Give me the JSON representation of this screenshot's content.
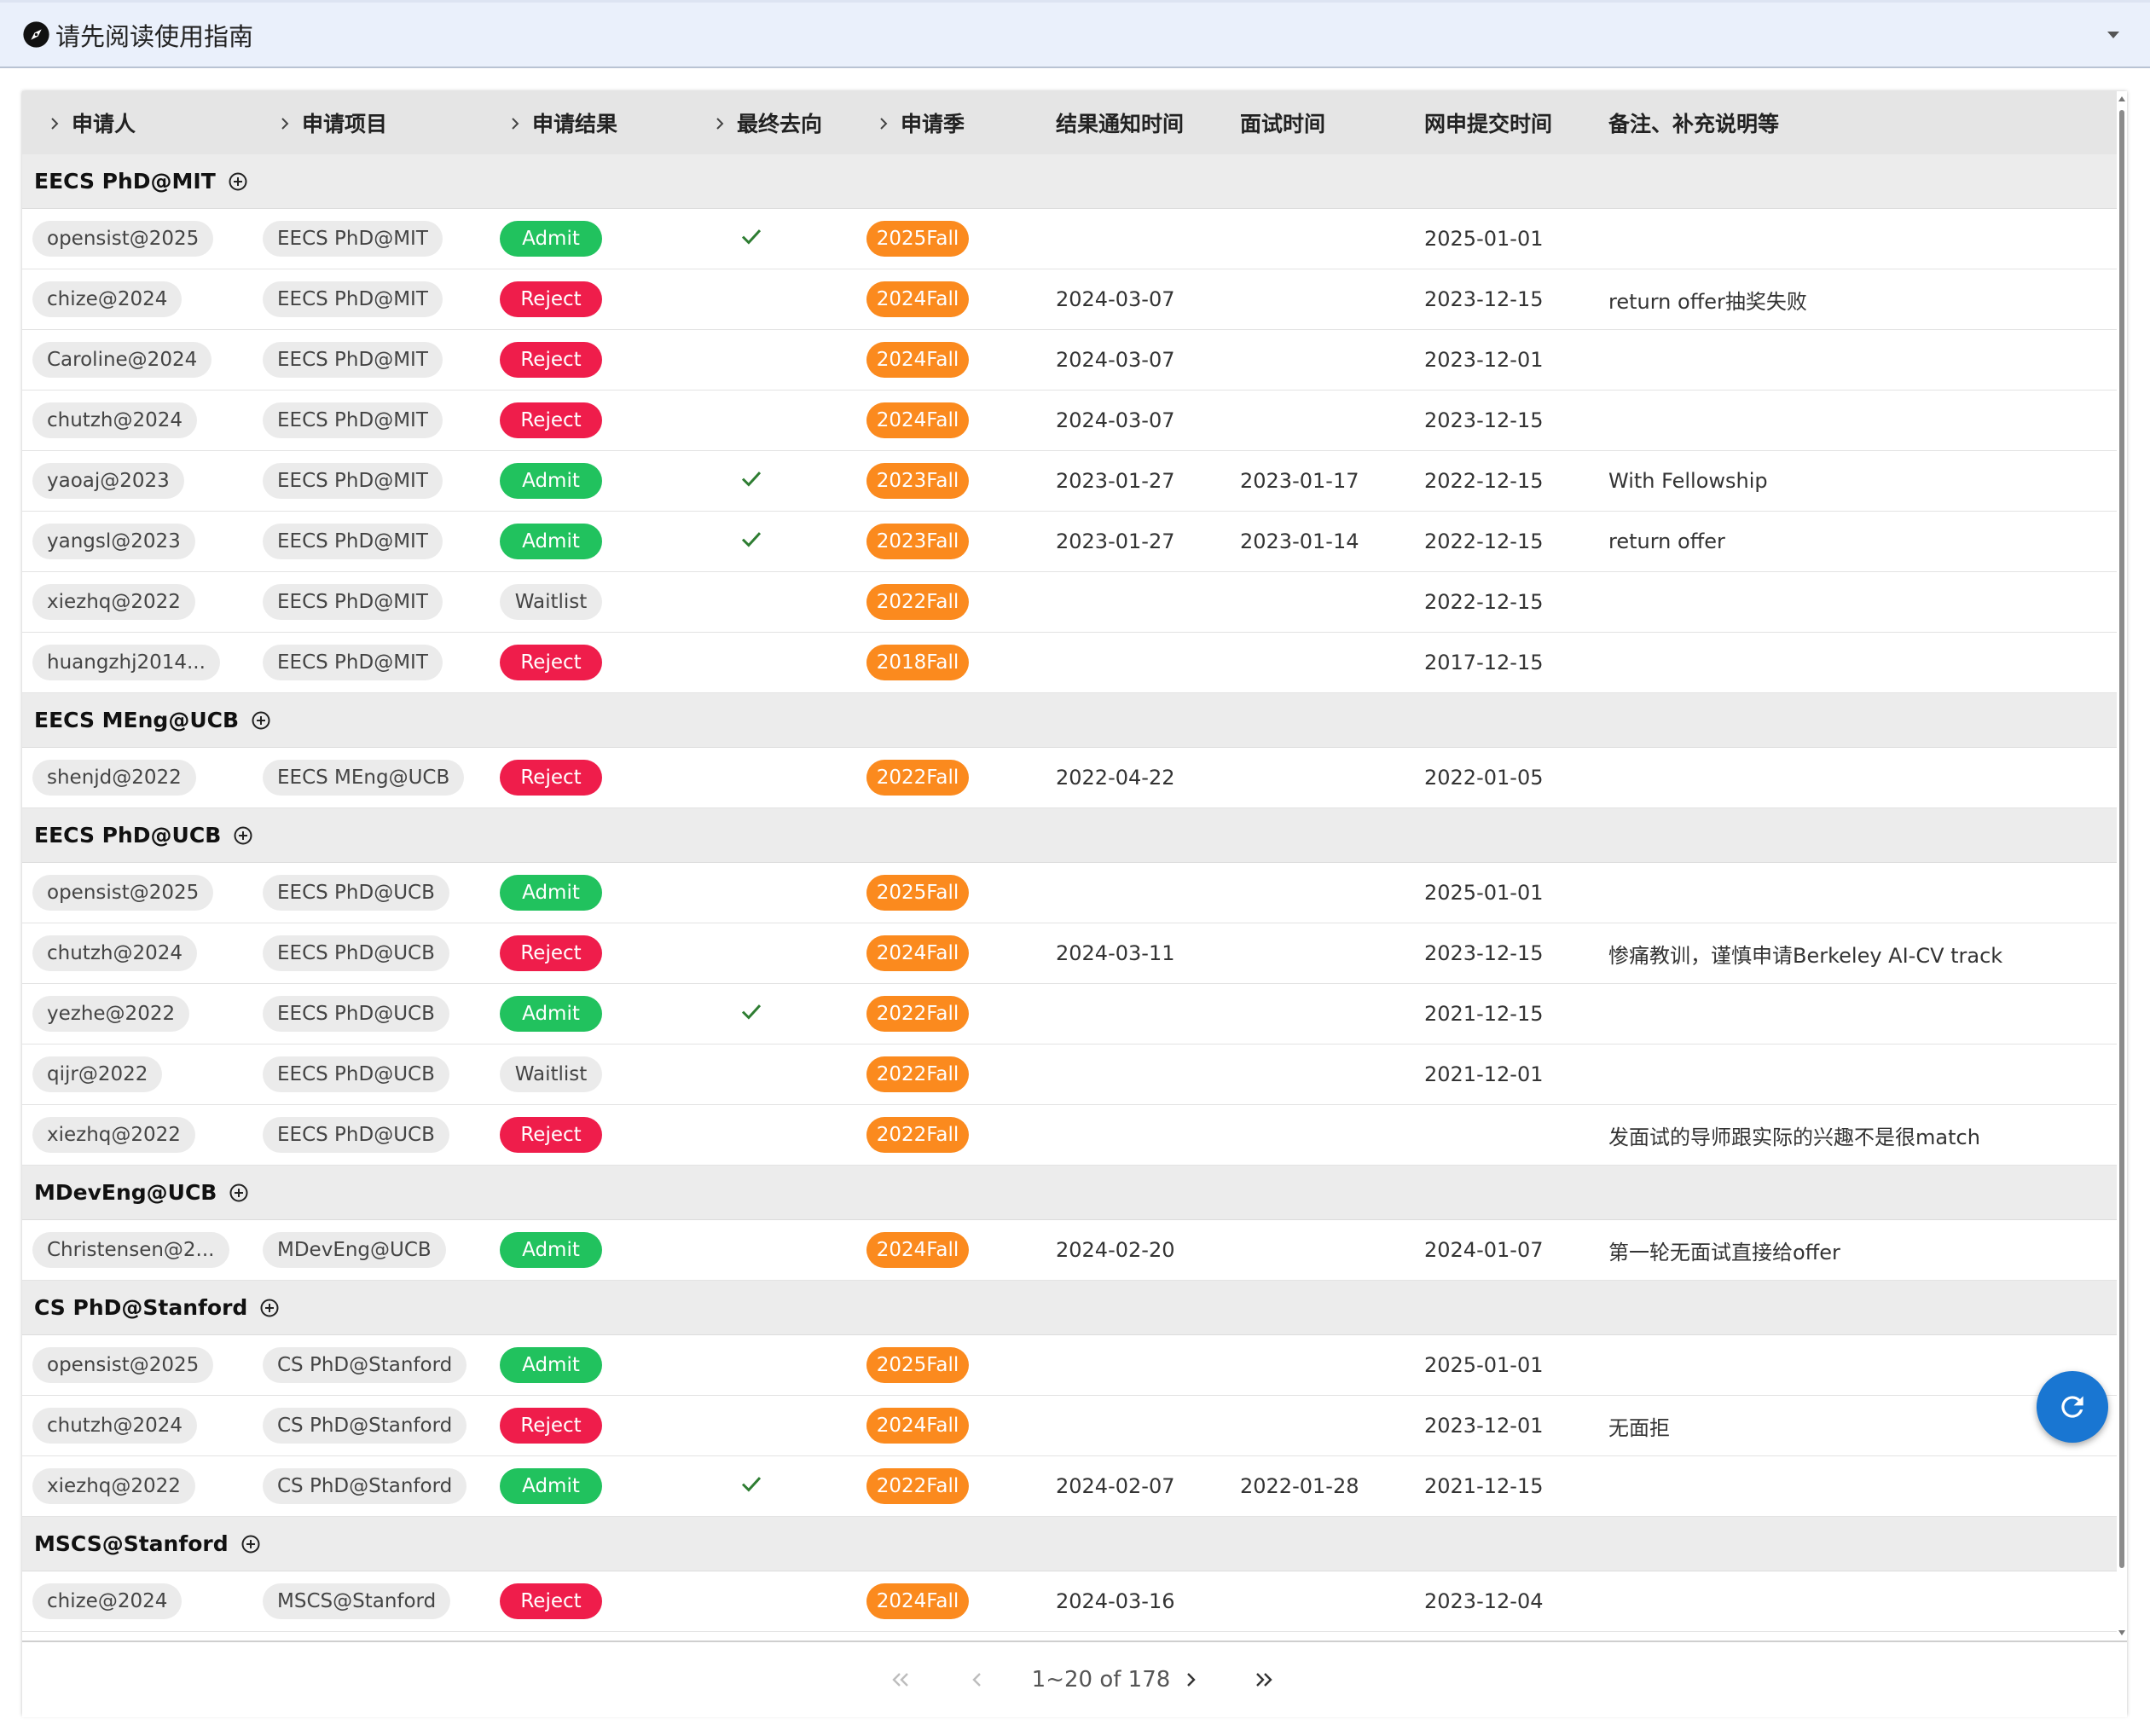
{
  "guide": {
    "title": "请先阅读使用指南"
  },
  "columns": [
    {
      "label": "申请人",
      "sortable": true
    },
    {
      "label": "申请项目",
      "sortable": true
    },
    {
      "label": "申请结果",
      "sortable": true
    },
    {
      "label": "最终去向",
      "sortable": true
    },
    {
      "label": "申请季",
      "sortable": true
    },
    {
      "label": "结果通知时间",
      "sortable": false
    },
    {
      "label": "面试时间",
      "sortable": false
    },
    {
      "label": "网申提交时间",
      "sortable": false
    },
    {
      "label": "备注、补充说明等",
      "sortable": false
    }
  ],
  "groups": [
    {
      "name": "EECS PhD@MIT",
      "rows": [
        {
          "applicant": "opensist@2025",
          "program": "EECS PhD@MIT",
          "result": "Admit",
          "final": true,
          "season": "2025Fall",
          "notify": "",
          "interview": "",
          "submit": "2025-01-01",
          "note": ""
        },
        {
          "applicant": "chize@2024",
          "program": "EECS PhD@MIT",
          "result": "Reject",
          "final": false,
          "season": "2024Fall",
          "notify": "2024-03-07",
          "interview": "",
          "submit": "2023-12-15",
          "note": "return offer抽奖失败"
        },
        {
          "applicant": "Caroline@2024",
          "program": "EECS PhD@MIT",
          "result": "Reject",
          "final": false,
          "season": "2024Fall",
          "notify": "2024-03-07",
          "interview": "",
          "submit": "2023-12-01",
          "note": ""
        },
        {
          "applicant": "chutzh@2024",
          "program": "EECS PhD@MIT",
          "result": "Reject",
          "final": false,
          "season": "2024Fall",
          "notify": "2024-03-07",
          "interview": "",
          "submit": "2023-12-15",
          "note": ""
        },
        {
          "applicant": "yaoaj@2023",
          "program": "EECS PhD@MIT",
          "result": "Admit",
          "final": true,
          "season": "2023Fall",
          "notify": "2023-01-27",
          "interview": "2023-01-17",
          "submit": "2022-12-15",
          "note": "With Fellowship"
        },
        {
          "applicant": "yangsl@2023",
          "program": "EECS PhD@MIT",
          "result": "Admit",
          "final": true,
          "season": "2023Fall",
          "notify": "2023-01-27",
          "interview": "2023-01-14",
          "submit": "2022-12-15",
          "note": "return offer"
        },
        {
          "applicant": "xiezhq@2022",
          "program": "EECS PhD@MIT",
          "result": "Waitlist",
          "final": false,
          "season": "2022Fall",
          "notify": "",
          "interview": "",
          "submit": "2022-12-15",
          "note": ""
        },
        {
          "applicant": "huangzhj2014...",
          "program": "EECS PhD@MIT",
          "result": "Reject",
          "final": false,
          "season": "2018Fall",
          "notify": "",
          "interview": "",
          "submit": "2017-12-15",
          "note": ""
        }
      ]
    },
    {
      "name": "EECS MEng@UCB",
      "rows": [
        {
          "applicant": "shenjd@2022",
          "program": "EECS MEng@UCB",
          "result": "Reject",
          "final": false,
          "season": "2022Fall",
          "notify": "2022-04-22",
          "interview": "",
          "submit": "2022-01-05",
          "note": ""
        }
      ]
    },
    {
      "name": "EECS PhD@UCB",
      "rows": [
        {
          "applicant": "opensist@2025",
          "program": "EECS PhD@UCB",
          "result": "Admit",
          "final": false,
          "season": "2025Fall",
          "notify": "",
          "interview": "",
          "submit": "2025-01-01",
          "note": ""
        },
        {
          "applicant": "chutzh@2024",
          "program": "EECS PhD@UCB",
          "result": "Reject",
          "final": false,
          "season": "2024Fall",
          "notify": "2024-03-11",
          "interview": "",
          "submit": "2023-12-15",
          "note": "惨痛教训，谨慎申请Berkeley AI-CV track"
        },
        {
          "applicant": "yezhe@2022",
          "program": "EECS PhD@UCB",
          "result": "Admit",
          "final": true,
          "season": "2022Fall",
          "notify": "",
          "interview": "",
          "submit": "2021-12-15",
          "note": ""
        },
        {
          "applicant": "qijr@2022",
          "program": "EECS PhD@UCB",
          "result": "Waitlist",
          "final": false,
          "season": "2022Fall",
          "notify": "",
          "interview": "",
          "submit": "2021-12-01",
          "note": ""
        },
        {
          "applicant": "xiezhq@2022",
          "program": "EECS PhD@UCB",
          "result": "Reject",
          "final": false,
          "season": "2022Fall",
          "notify": "",
          "interview": "",
          "submit": "",
          "note": "发面试的导师跟实际的兴趣不是很match"
        }
      ]
    },
    {
      "name": "MDevEng@UCB",
      "rows": [
        {
          "applicant": "Christensen@2...",
          "program": "MDevEng@UCB",
          "result": "Admit",
          "final": false,
          "season": "2024Fall",
          "notify": "2024-02-20",
          "interview": "",
          "submit": "2024-01-07",
          "note": "第一轮无面试直接给offer"
        }
      ]
    },
    {
      "name": "CS PhD@Stanford",
      "rows": [
        {
          "applicant": "opensist@2025",
          "program": "CS PhD@Stanford",
          "result": "Admit",
          "final": false,
          "season": "2025Fall",
          "notify": "",
          "interview": "",
          "submit": "2025-01-01",
          "note": ""
        },
        {
          "applicant": "chutzh@2024",
          "program": "CS PhD@Stanford",
          "result": "Reject",
          "final": false,
          "season": "2024Fall",
          "notify": "",
          "interview": "",
          "submit": "2023-12-01",
          "note": "无面拒"
        },
        {
          "applicant": "xiezhq@2022",
          "program": "CS PhD@Stanford",
          "result": "Admit",
          "final": true,
          "season": "2022Fall",
          "notify": "2024-02-07",
          "interview": "2022-01-28",
          "submit": "2021-12-15",
          "note": ""
        }
      ]
    },
    {
      "name": "MSCS@Stanford",
      "rows": [
        {
          "applicant": "chize@2024",
          "program": "MSCS@Stanford",
          "result": "Reject",
          "final": false,
          "season": "2024Fall",
          "notify": "2024-03-16",
          "interview": "",
          "submit": "2023-12-04",
          "note": ""
        }
      ]
    }
  ],
  "pagination": {
    "label": "1~20 of 178"
  },
  "colors": {
    "admit": "#21c25e",
    "reject": "#ef1d4b",
    "season": "#fb8a1e",
    "check": "#2e7d32",
    "fab": "#1976d2"
  },
  "icons": {
    "guide": "compass-icon",
    "expand": "chevron-down-icon",
    "sort": "chevron-right-icon",
    "group": "plus-circle-icon",
    "final": "check-icon",
    "refresh": "refresh-icon",
    "first": "first-page-icon",
    "prev": "prev-page-icon",
    "next": "next-page-icon",
    "last": "last-page-icon"
  }
}
